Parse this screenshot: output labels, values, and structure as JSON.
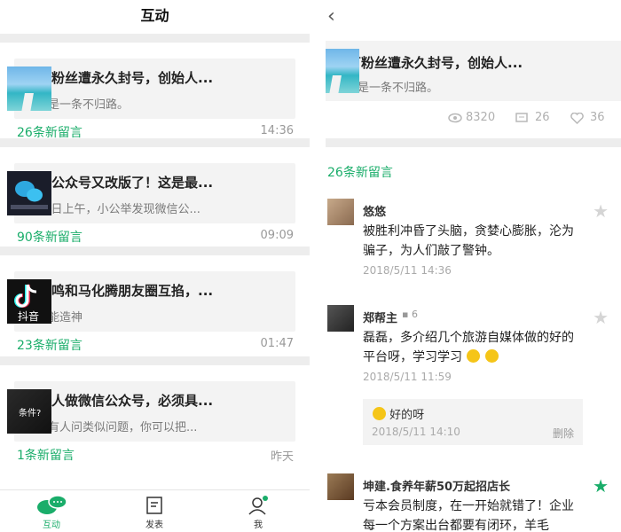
{
  "left": {
    "title": "互动",
    "cards": [
      {
        "title": "百万粉丝遭永久封号，创始人...",
        "desc": "创业是一条不归路。",
        "count": "26条新留言",
        "time": "14:36",
        "thumb_label": ""
      },
      {
        "title": "微信公众号又改版了！这是最...",
        "desc": "5月8日上午，小公举发现微信公...",
        "count": "90条新留言",
        "time": "09:09",
        "thumb_label": ""
      },
      {
        "title": "张一鸣和马化腾朋友圈互掐，...",
        "desc": "抖音能造神",
        "count": "23条新留言",
        "time": "01:47",
        "thumb_label": "抖音"
      },
      {
        "title": "普通人做微信公众号，必须具...",
        "desc": "以后有人问类似问题，你可以把...",
        "count": "1条新留言",
        "time": "昨天",
        "thumb_label": "条件?"
      }
    ],
    "tabs": [
      {
        "label": "互动",
        "icon": "chat-bubbles-icon",
        "active": true
      },
      {
        "label": "发表",
        "icon": "document-icon",
        "active": false
      },
      {
        "label": "我",
        "icon": "person-icon",
        "active": false
      }
    ]
  },
  "right": {
    "article": {
      "title": "百万粉丝遭永久封号，创始人...",
      "desc": "创业是一条不归路。"
    },
    "stats": {
      "views": "8320",
      "comments": "26",
      "likes": "36"
    },
    "count": "26条新留言",
    "comments": [
      {
        "name": "悠悠",
        "text": "被胜利冲昏了头脑，贪婪心膨胀，沦为骗子，为人们敲了警钟。",
        "time": "2018/5/11 14:36",
        "starred": false
      },
      {
        "name": "郑帮主",
        "reply_count": "6",
        "text": "磊磊，多介绍几个旅游自媒体做的好的平台呀，学习学习",
        "time": "2018/5/11 11:59",
        "starred": false,
        "reply": {
          "text": "好的呀",
          "time": "2018/5/11 14:10",
          "delete": "删除"
        }
      },
      {
        "name": "坤建.食养年薪50万起招店长",
        "text": "亏本会员制度，在一开始就错了！企业每一个方案出台都要有闭环，羊毛",
        "starred": true
      }
    ]
  },
  "colors": {
    "accent": "#1aad6a",
    "gray_bg": "#ededed",
    "card_bg": "#f3f3f3"
  }
}
